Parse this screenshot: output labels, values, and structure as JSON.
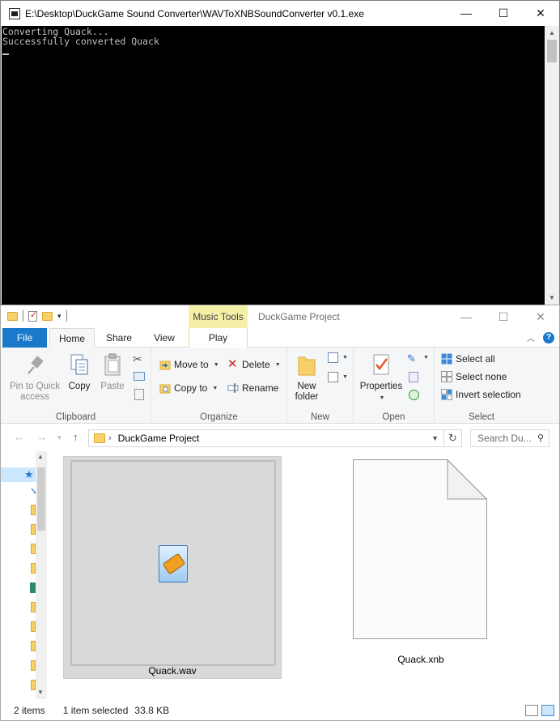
{
  "console": {
    "title": "E:\\Desktop\\DuckGame Sound Converter\\WAVToXNBSoundConverter v0.1.exe",
    "lines": [
      "Converting Quack...",
      "Successfully converted Quack"
    ]
  },
  "window_controls": {
    "minimize": "—",
    "maximize": "☐",
    "close": "✕"
  },
  "explorer": {
    "title": "DuckGame Project",
    "contextual_tab_group": "Music Tools",
    "tabs": {
      "file": "File",
      "home": "Home",
      "share": "Share",
      "view": "View",
      "play": "Play"
    },
    "ribbon": {
      "clipboard": {
        "label": "Clipboard",
        "pin": "Pin to Quick\naccess",
        "copy": "Copy",
        "paste": "Paste"
      },
      "organize": {
        "label": "Organize",
        "move_to": "Move to",
        "copy_to": "Copy to",
        "delete": "Delete",
        "rename": "Rename"
      },
      "new": {
        "label": "New",
        "new_folder": "New\nfolder"
      },
      "open": {
        "label": "Open",
        "properties": "Properties"
      },
      "select": {
        "label": "Select",
        "select_all": "Select all",
        "select_none": "Select none",
        "invert": "Invert selection"
      }
    },
    "address": {
      "path": "DuckGame Project",
      "search_placeholder": "Search Du..."
    },
    "files": [
      {
        "name": "Quack.wav",
        "selected": true,
        "icon": "audio-file-icon"
      },
      {
        "name": "Quack.xnb",
        "selected": false,
        "icon": "blank-document-icon"
      }
    ],
    "status": {
      "count": "2 items",
      "selected": "1 item selected",
      "size": "33.8 KB"
    }
  },
  "colors": {
    "accent": "#1979ca",
    "music_tools": "#f5f0a8",
    "selection": "#d9d9d9",
    "console_bg": "#000000",
    "console_text": "#c0c0c0"
  }
}
